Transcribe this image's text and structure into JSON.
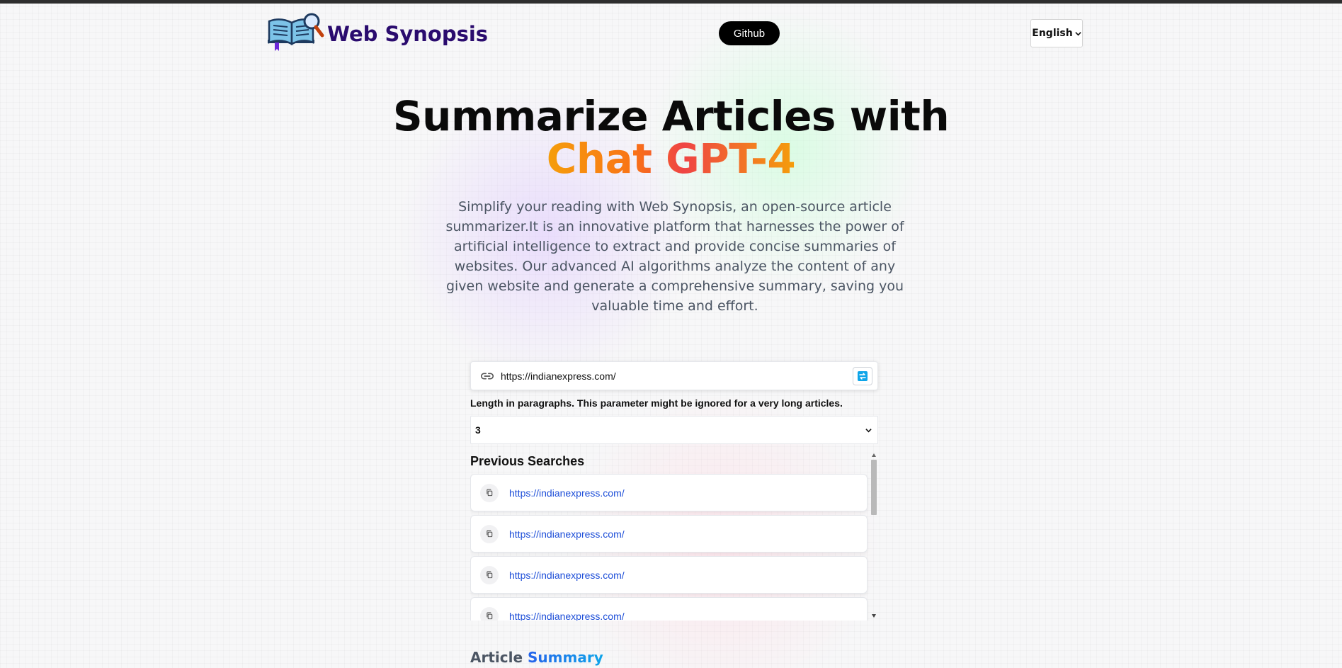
{
  "brand": {
    "name": "Web Synopsis",
    "logo_icon": "open-book-magnifier-icon"
  },
  "nav": {
    "github_label": "Github",
    "language_selected": "English"
  },
  "hero": {
    "title_line1": "Summarize Articles with",
    "title_line2": "Chat GPT-4",
    "description": "Simplify your reading with Web Synopsis, an open-source article summarizer.It is an innovative platform that harnesses the power of artificial intelligence to extract and provide concise summaries of websites. Our advanced AI algorithms analyze the content of any given website and generate a comprehensive summary, saving you valuable time and effort."
  },
  "search": {
    "url_value": "https://indianexpress.com/",
    "length_label": "Length in paragraphs. This parameter might be ignored for a very long articles.",
    "length_selected": "3"
  },
  "history": {
    "title": "Previous Searches",
    "items": [
      "https://indianexpress.com/",
      "https://indianexpress.com/",
      "https://indianexpress.com/",
      "https://indianexpress.com/"
    ]
  },
  "summary": {
    "title_plain": "Article",
    "title_accent": "Summary"
  },
  "colors": {
    "brand": "#2a0b6e",
    "link": "#1d4ed8",
    "accent_orange": "#f97316",
    "accent_red": "#ef4444",
    "accent_blue": "#2563eb"
  }
}
